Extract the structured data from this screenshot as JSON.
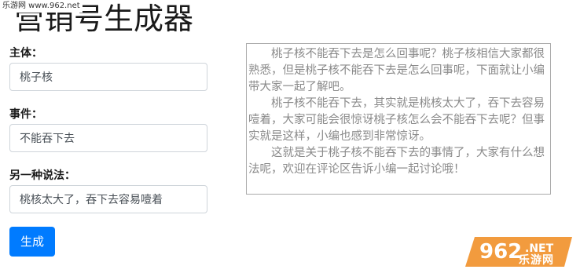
{
  "watermark": {
    "top_text": "乐游网 www.962.net",
    "logo_number": "962",
    "logo_suffix": ".NET",
    "logo_cn": "乐游网"
  },
  "page": {
    "title": "营销号生成器"
  },
  "form": {
    "subject_label": "主体：",
    "subject_value": "桃子核",
    "event_label": "事件：",
    "event_value": "不能吞下去",
    "alt_label": "另一种说法：",
    "alt_value": "桃核太大了，吞下去容易噎着",
    "generate_label": "生成"
  },
  "output": {
    "paragraphs": [
      "桃子核不能吞下去是怎么回事呢？桃子核相信大家都很熟悉，但是桃子核不能吞下去是怎么回事呢，下面就让小编带大家一起了解吧。",
      "桃子核不能吞下去，其实就是桃核太大了，吞下去容易噎着，大家可能会很惊讶桃子核怎么会不能吞下去呢？但事实就是这样，小编也感到非常惊讶。",
      "这就是关于桃子核不能吞下去的事情了，大家有什么想法呢，欢迎在评论区告诉小编一起讨论哦！"
    ]
  },
  "colors": {
    "primary_button": "#007bff",
    "output_text": "#8a8a8a",
    "logo_orange": "#f08a1c"
  }
}
